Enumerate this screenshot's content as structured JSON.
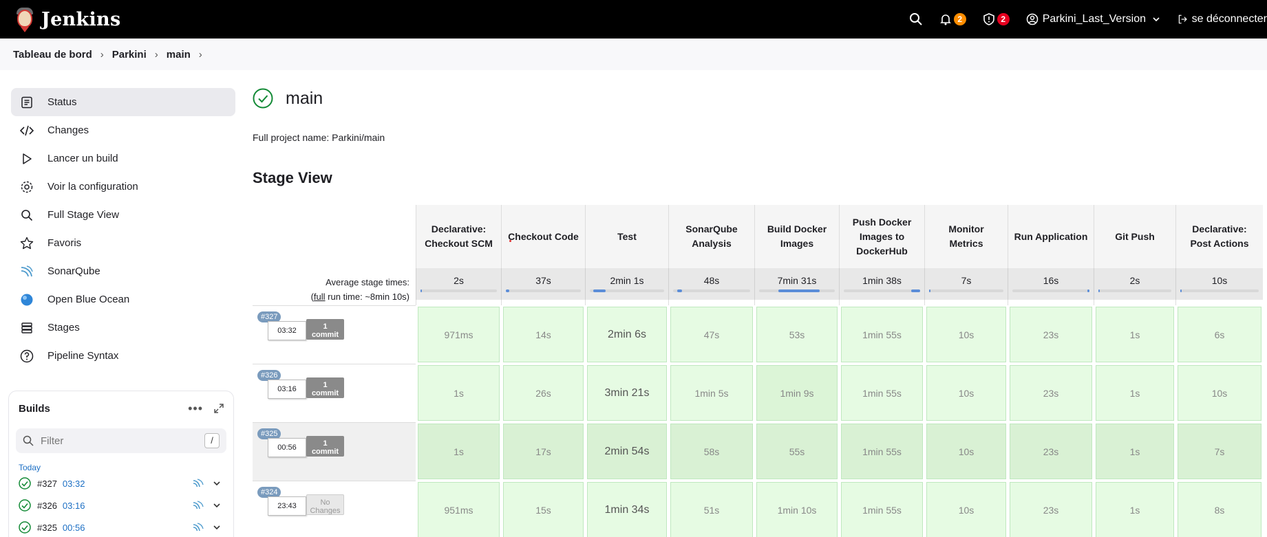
{
  "header": {
    "brand": "Jenkins",
    "notifications_count": "2",
    "security_count": "2",
    "user": "Parkini_Last_Version",
    "logout": "se déconnecter",
    "colors": {
      "notif_badge": "#fe8d00",
      "security_badge": "#e6001f",
      "bar": "#000000"
    }
  },
  "breadcrumb": [
    "Tableau de bord",
    "Parkini",
    "main"
  ],
  "sidebar": {
    "items": [
      {
        "label": "Status",
        "icon": "status-icon"
      },
      {
        "label": "Changes",
        "icon": "code-icon"
      },
      {
        "label": "Lancer un build",
        "icon": "play-icon"
      },
      {
        "label": "Voir la configuration",
        "icon": "gear-icon"
      },
      {
        "label": "Full Stage View",
        "icon": "search-icon"
      },
      {
        "label": "Favoris",
        "icon": "star-icon"
      },
      {
        "label": "SonarQube",
        "icon": "sonarqube-icon"
      },
      {
        "label": "Open Blue Ocean",
        "icon": "blue-ocean-icon"
      },
      {
        "label": "Stages",
        "icon": "layers-icon"
      },
      {
        "label": "Pipeline Syntax",
        "icon": "help-icon"
      }
    ]
  },
  "builds": {
    "title": "Builds",
    "filter_placeholder": "Filter",
    "filter_shortcut": "/",
    "group": "Today",
    "list": [
      {
        "num": "#327",
        "time": "03:32"
      },
      {
        "num": "#326",
        "time": "03:16"
      },
      {
        "num": "#325",
        "time": "00:56"
      }
    ]
  },
  "main": {
    "title": "main",
    "full_name": "Full project name: Parkini/main",
    "stage_view_title": "Stage View"
  },
  "stage_view": {
    "avg_label_1": "Average stage times:",
    "avg_label_2_prefix": "(",
    "avg_label_2_link": "full",
    "avg_label_2_suffix": " run time: ~8min 10s)",
    "stages": [
      {
        "name": "Declarative: Checkout SCM",
        "avg": "2s",
        "fill": 0.02
      },
      {
        "name": "Checkout Code",
        "avg": "37s",
        "fill": 0.05
      },
      {
        "name": "Test",
        "avg": "2min 1s",
        "fill": 0.16
      },
      {
        "name": "SonarQube Analysis",
        "avg": "48s",
        "fill": 0.07
      },
      {
        "name": "Build Docker Images",
        "avg": "7min 31s",
        "fill": 0.55
      },
      {
        "name": "Push Docker Images to DockerHub",
        "avg": "1min 38s",
        "fill": 0.12
      },
      {
        "name": "Monitor Metrics",
        "avg": "7s",
        "fill": 0.01
      },
      {
        "name": "Run Application",
        "avg": "16s",
        "fill": 0.03
      },
      {
        "name": "Git Push",
        "avg": "2s",
        "fill": 0.01
      },
      {
        "name": "Declarative: Post Actions",
        "avg": "10s",
        "fill": 0.01
      }
    ],
    "runs": [
      {
        "num": "#327",
        "time": "03:32",
        "changes": "1",
        "changes_label": "commit",
        "cells": [
          "971ms",
          "14s",
          "2min 6s",
          "47s",
          "53s",
          "1min 55s",
          "10s",
          "23s",
          "1s",
          "6s"
        ]
      },
      {
        "num": "#326",
        "time": "03:16",
        "changes": "1",
        "changes_label": "commit",
        "cells": [
          "1s",
          "26s",
          "3min 21s",
          "1min 5s",
          "1min 9s",
          "1min 55s",
          "10s",
          "23s",
          "1s",
          "10s"
        ]
      },
      {
        "num": "#325",
        "time": "00:56",
        "changes": "1",
        "changes_label": "commit",
        "cells": [
          "1s",
          "17s",
          "2min 54s",
          "58s",
          "55s",
          "1min 55s",
          "10s",
          "23s",
          "1s",
          "7s"
        ]
      },
      {
        "num": "#324",
        "time": "23:43",
        "changes": "No",
        "changes_label": "Changes",
        "cells": [
          "951ms",
          "15s",
          "1min 34s",
          "51s",
          "1min 10s",
          "1min 55s",
          "10s",
          "23s",
          "1s",
          "8s"
        ]
      }
    ]
  }
}
